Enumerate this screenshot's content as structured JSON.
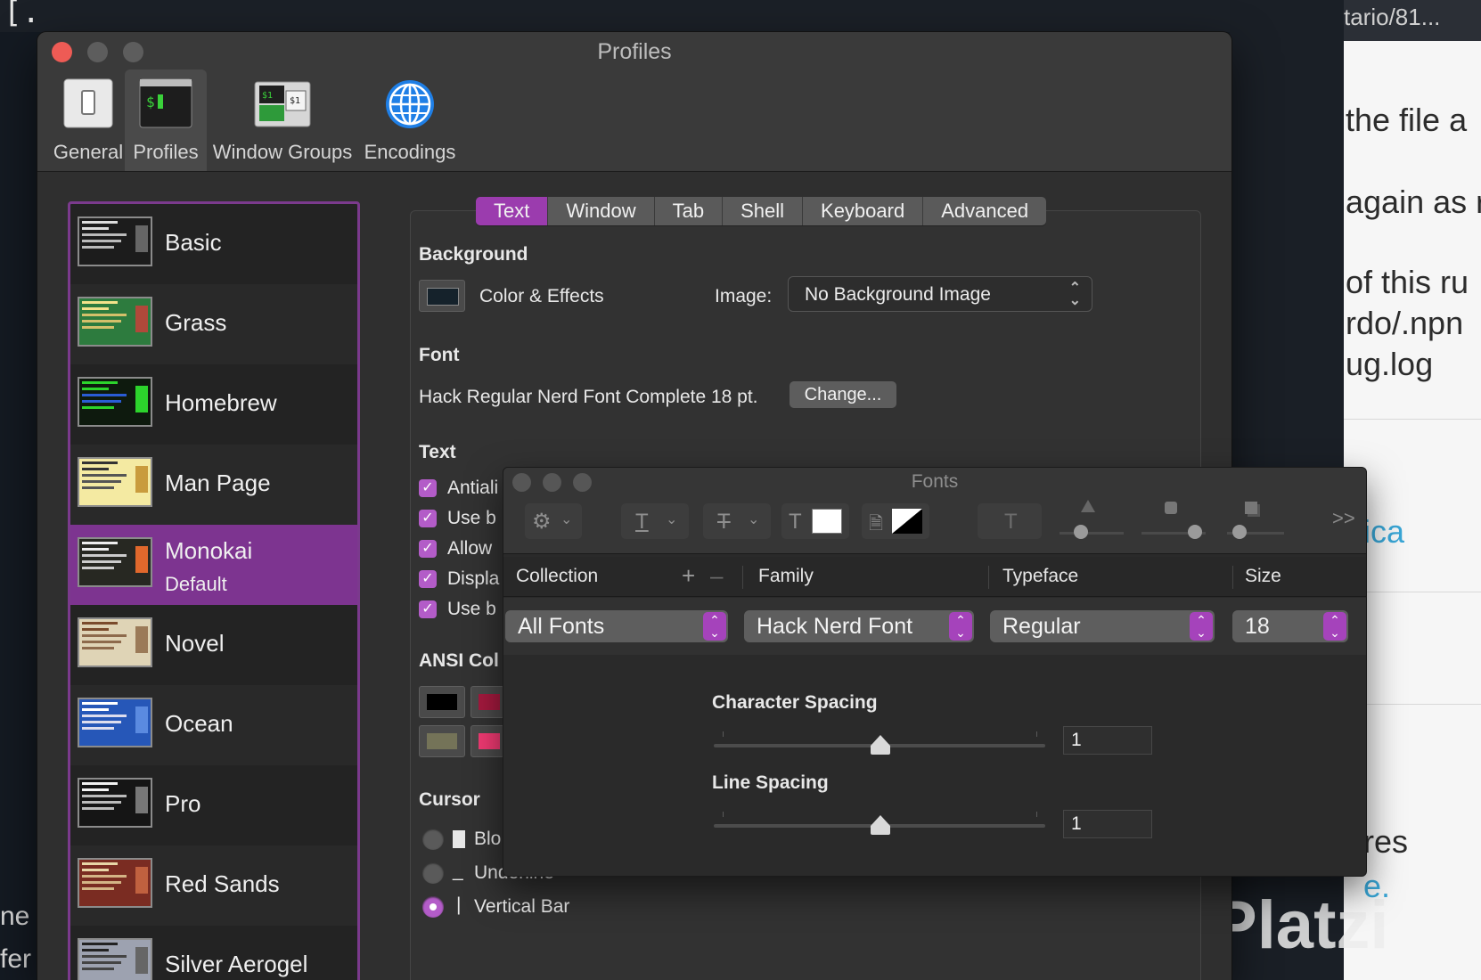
{
  "background": {
    "url_fragment": "tario/81...",
    "page_lines": [
      "the file a",
      "again as r",
      "of this ru",
      "rdo/.npn",
      "ug.log"
    ],
    "link_text": "ica",
    "lower_lines": [
      "res",
      "e."
    ],
    "left_lines": [
      "ne",
      "fer"
    ],
    "watermark": "Platzi"
  },
  "window": {
    "title": "Profiles",
    "toolbar": [
      {
        "label": "General",
        "icon": "general-icon"
      },
      {
        "label": "Profiles",
        "icon": "profiles-icon"
      },
      {
        "label": "Window Groups",
        "icon": "window-groups-icon"
      },
      {
        "label": "Encodings",
        "icon": "globe-icon"
      }
    ]
  },
  "profiles": [
    {
      "name": "Basic",
      "sub": ""
    },
    {
      "name": "Grass",
      "sub": ""
    },
    {
      "name": "Homebrew",
      "sub": ""
    },
    {
      "name": "Man Page",
      "sub": ""
    },
    {
      "name": "Monokai",
      "sub": "Default"
    },
    {
      "name": "Novel",
      "sub": ""
    },
    {
      "name": "Ocean",
      "sub": ""
    },
    {
      "name": "Pro",
      "sub": ""
    },
    {
      "name": "Red Sands",
      "sub": ""
    },
    {
      "name": "Silver Aerogel",
      "sub": ""
    }
  ],
  "tabs": [
    "Text",
    "Window",
    "Tab",
    "Shell",
    "Keyboard",
    "Advanced"
  ],
  "settings": {
    "background_heading": "Background",
    "color_effects": "Color & Effects",
    "image_label": "Image:",
    "image_value": "No Background Image",
    "font_heading": "Font",
    "font_value": "Hack Regular Nerd Font Complete 18 pt.",
    "change_button": "Change...",
    "text_heading": "Text",
    "text_options": [
      "Antiali",
      "Use b",
      "Allow",
      "Displa",
      "Use b"
    ],
    "ansi_heading": "ANSI Col",
    "cursor_heading": "Cursor",
    "cursor_options": [
      "Blo",
      "Underline",
      "Vertical Bar"
    ]
  },
  "fonts_panel": {
    "title": "Fonts",
    "columns": [
      "Collection",
      "Family",
      "Typeface",
      "Size"
    ],
    "collection": "All Fonts",
    "family": "Hack Nerd Font",
    "typeface": "Regular",
    "size": "18",
    "character_spacing_label": "Character Spacing",
    "character_spacing_value": "1",
    "line_spacing_label": "Line Spacing",
    "line_spacing_value": "1",
    "more_icon": ">>"
  },
  "colors": {
    "accent": "#9b3cae",
    "selection": "#7d3490"
  }
}
